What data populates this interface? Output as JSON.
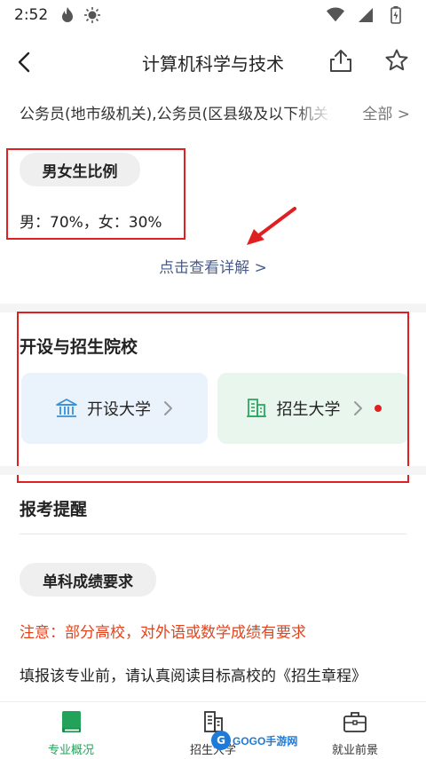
{
  "status_bar": {
    "time": "2:52",
    "icons": [
      "flame-icon",
      "brightness-icon",
      "wifi-icon",
      "cell-signal-icon",
      "battery-icon"
    ]
  },
  "header": {
    "title": "计算机科学与技术",
    "back_icon": "chevron-left-icon",
    "share_icon": "share-icon",
    "favorite_icon": "star-icon"
  },
  "jobs": {
    "text": "公务员(地市级机关),公务员(区县级及以下机关)",
    "all_label": "全部 >"
  },
  "gender": {
    "chip_label": "男女生比例",
    "ratio_text": "男：70%，女：30%",
    "detail_link": "点击查看详解 >"
  },
  "schools": {
    "section_title": "开设与招生院校",
    "open_card_label": "开设大学",
    "recruit_card_label": "招生大学"
  },
  "reminder": {
    "section_title": "报考提醒",
    "chip_label": "单科成绩要求",
    "notice": "注意：部分高校，对外语或数学成绩有要求",
    "body": "填报该专业前，请认真阅读目标高校的《招生章程》"
  },
  "bottom_nav": {
    "items": [
      {
        "label": "专业概况",
        "icon": "book-icon",
        "active": true
      },
      {
        "label": "招生大学",
        "icon": "building-icon",
        "active": false
      },
      {
        "label": "就业前景",
        "icon": "briefcase-icon",
        "active": false
      }
    ]
  },
  "watermark": {
    "logo": "G",
    "text": "GOGO手游网"
  },
  "colors": {
    "accent_green": "#23a35a",
    "notice_red": "#e0451f",
    "annotation_red": "#e02020",
    "link_blue": "#4a5c8a",
    "open_card_bg": "#eaf2fb",
    "recruit_card_bg": "#e9f6ee"
  }
}
